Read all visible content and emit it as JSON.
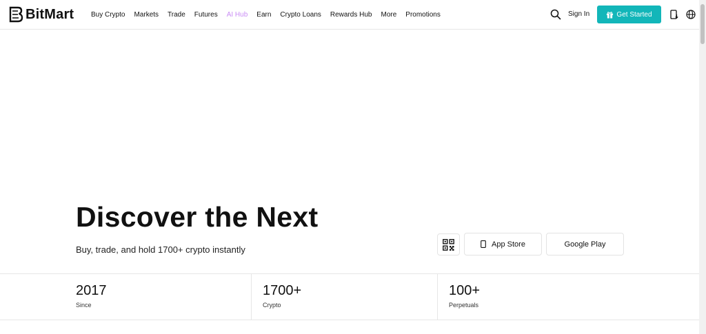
{
  "brand": {
    "name": "BitMart"
  },
  "nav": {
    "items": [
      {
        "label": "Buy Crypto"
      },
      {
        "label": "Markets"
      },
      {
        "label": "Trade"
      },
      {
        "label": "Futures"
      },
      {
        "label": "AI Hub"
      },
      {
        "label": "Earn"
      },
      {
        "label": "Crypto Loans"
      },
      {
        "label": "Rewards Hub"
      },
      {
        "label": "More"
      },
      {
        "label": "Promotions"
      }
    ]
  },
  "header": {
    "sign_in": "Sign In",
    "get_started": "Get Started",
    "icons": [
      "search-icon",
      "gift-icon",
      "download-icon",
      "globe-icon"
    ]
  },
  "hero": {
    "title": "Discover the Next",
    "subtitle": "Buy, trade, and hold 1700+ crypto instantly",
    "app_store": "App Store",
    "google_play": "Google Play"
  },
  "stats": [
    {
      "value": "2017",
      "label": "Since"
    },
    {
      "value": "1700+",
      "label": "Crypto"
    },
    {
      "value": "100+",
      "label": "Perpetuals"
    }
  ],
  "colors": {
    "accent": "#12b6b9",
    "ai_hub": "#c98cf5",
    "text": "#111111",
    "border": "#e6e6e6"
  }
}
